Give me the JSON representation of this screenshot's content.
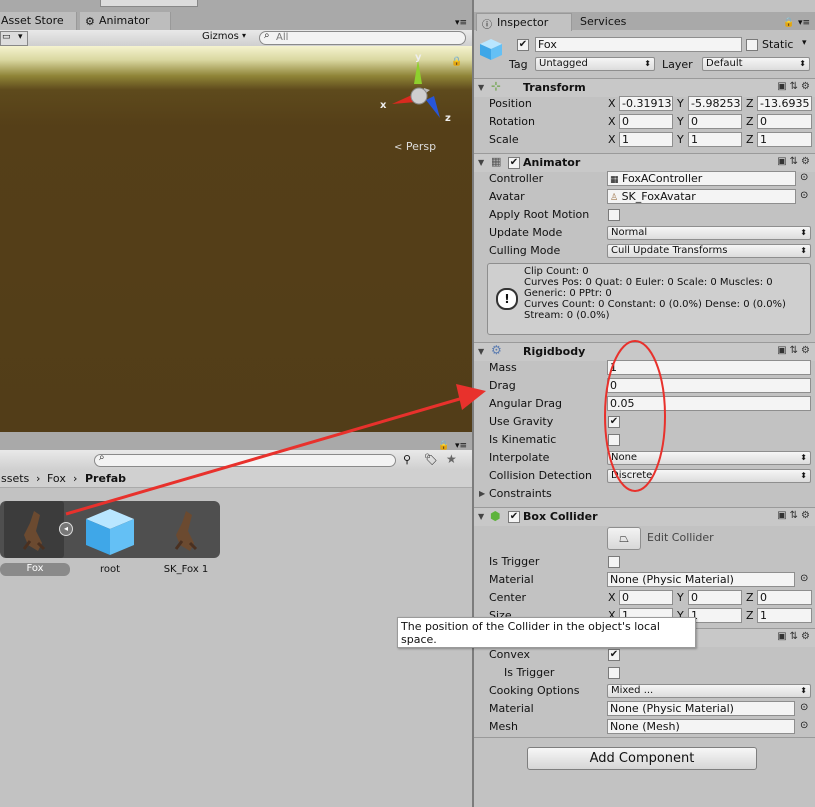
{
  "top_tabs": {
    "asset_store": "Asset Store",
    "animator": "Animator"
  },
  "scene_toolbar": {
    "gizmos": "Gizmos",
    "search_placeholder": "All"
  },
  "gizmo": {
    "y": "y",
    "x": "x",
    "z": "z",
    "persp": "Persp"
  },
  "project": {
    "breadcrumb": {
      "assets": "ssets",
      "fox": "Fox",
      "prefab": "Prefab"
    },
    "items": [
      {
        "label": "Fox"
      },
      {
        "label": "root"
      },
      {
        "label": "SK_Fox 1"
      }
    ]
  },
  "inspector": {
    "tabs": {
      "inspector": "Inspector",
      "services": "Services"
    },
    "object": {
      "name": "Fox",
      "static_label": "Static",
      "tag_label": "Tag",
      "tag_value": "Untagged",
      "layer_label": "Layer",
      "layer_value": "Default"
    },
    "transform": {
      "title": "Transform",
      "position_label": "Position",
      "rotation_label": "Rotation",
      "scale_label": "Scale",
      "position": [
        "-0.31913",
        "-5.98253",
        "-13.6935"
      ],
      "rotation": [
        "0",
        "0",
        "0"
      ],
      "scale": [
        "1",
        "1",
        "1"
      ]
    },
    "axes": {
      "x": "X",
      "y": "Y",
      "z": "Z"
    },
    "animator": {
      "title": "Animator",
      "controller_label": "Controller",
      "controller_value": "FoxAController",
      "avatar_label": "Avatar",
      "avatar_value": "SK_FoxAvatar",
      "apply_root_label": "Apply Root Motion",
      "update_mode_label": "Update Mode",
      "update_mode_value": "Normal",
      "culling_mode_label": "Culling Mode",
      "culling_mode_value": "Cull Update Transforms",
      "info": [
        "Clip Count: 0",
        "Curves Pos: 0 Quat: 0 Euler: 0 Scale: 0 Muscles: 0",
        "Generic: 0 PPtr: 0",
        "Curves Count: 0 Constant: 0 (0.0%) Dense: 0 (0.0%)",
        "Stream: 0 (0.0%)"
      ]
    },
    "rigidbody": {
      "title": "Rigidbody",
      "mass_label": "Mass",
      "mass": "1",
      "drag_label": "Drag",
      "drag": "0",
      "angular_drag_label": "Angular Drag",
      "angular_drag": "0.05",
      "use_gravity_label": "Use Gravity",
      "is_kinematic_label": "Is Kinematic",
      "interpolate_label": "Interpolate",
      "interpolate_value": "None",
      "collision_label": "Collision Detection",
      "collision_value": "Discrete",
      "constraints_label": "Constraints"
    },
    "box_collider": {
      "title": "Box Collider",
      "edit_label": "Edit Collider",
      "is_trigger_label": "Is Trigger",
      "material_label": "Material",
      "material_value": "None (Physic Material)",
      "center_label": "Center",
      "center": [
        "0",
        "0",
        "0"
      ],
      "size_label": "Size",
      "size": [
        "1",
        "1",
        "1"
      ]
    },
    "tooltip": {
      "line1": "The position of the Collider in the object's local",
      "line2": "space."
    },
    "mesh_collider": {
      "convex_label": "Convex",
      "is_trigger_label": "Is Trigger",
      "cooking_label": "Cooking Options",
      "cooking_value": "Mixed ...",
      "material_label": "Material",
      "material_value": "None (Physic Material)",
      "mesh_label": "Mesh",
      "mesh_value": "None (Mesh)"
    },
    "add_component": "Add Component"
  },
  "colors": {
    "annotation_red": "#e8312c",
    "scene_ground": "#5a4217"
  }
}
